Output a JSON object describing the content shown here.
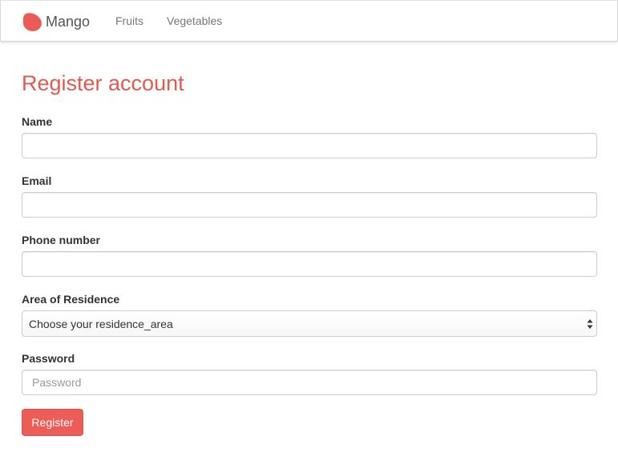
{
  "navbar": {
    "brand_icon": "mango-icon",
    "brand_name": "Mango",
    "links": [
      {
        "label": "Fruits"
      },
      {
        "label": "Vegetables"
      }
    ]
  },
  "form": {
    "title": "Register account",
    "name": {
      "label": "Name",
      "value": "",
      "placeholder": ""
    },
    "email": {
      "label": "Email",
      "value": "",
      "placeholder": ""
    },
    "phone": {
      "label": "Phone number",
      "value": "",
      "placeholder": ""
    },
    "residence": {
      "label": "Area of Residence",
      "selected": "Choose your residence_area",
      "icon": "select-arrows-icon"
    },
    "password": {
      "label": "Password",
      "value": "",
      "placeholder": "Password"
    },
    "submit_label": "Register"
  },
  "colors": {
    "accent": "#e05a50",
    "button": "#ed5c56",
    "nav_text": "#777777"
  }
}
